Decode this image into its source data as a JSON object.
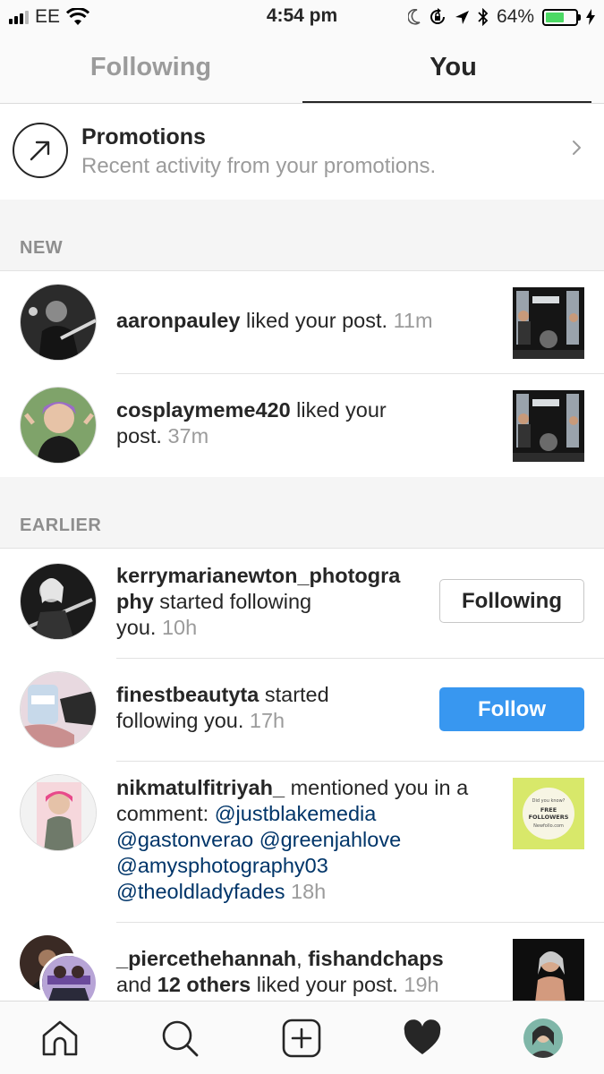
{
  "status_bar": {
    "carrier": "EE",
    "time": "4:54 pm",
    "battery_percent": "64%",
    "battery_level": 0.64,
    "icons": [
      "signal-icon",
      "wifi-icon",
      "moon-icon",
      "rotation-lock-icon",
      "location-icon",
      "bluetooth-icon",
      "battery-icon",
      "charging-icon"
    ]
  },
  "tabs": {
    "following": "Following",
    "you": "You",
    "active": "you"
  },
  "promotions": {
    "title": "Promotions",
    "subtitle": "Recent activity from your promotions.",
    "icon": "arrow-up-right-icon"
  },
  "sections": {
    "new": "NEW",
    "earlier": "EARLIER"
  },
  "new_items": [
    {
      "username": "aaronpauley",
      "action": " liked your post.",
      "time": "11m"
    },
    {
      "username": "cosplaymeme420",
      "action": " liked your post.",
      "time": "37m"
    }
  ],
  "earlier_items": [
    {
      "username": "kerrymarianewton_photography",
      "username_line1": "kerrymarianewton_photogra",
      "username_line2": "phy",
      "action": " started following you.",
      "action_line1": " started following",
      "action_line2": "you. ",
      "time": "10h",
      "button": "Following"
    },
    {
      "username": "finestbeautyta",
      "action_line1": " started",
      "action_line2": "following you. ",
      "time": "17h",
      "button": "Follow"
    },
    {
      "username": "nikmatulfitriyah_",
      "action_line1": " mentioned you in a",
      "action_line2": "comment: ",
      "mentions": [
        "@justblakemedia",
        "@gastonverao",
        "@greenjahlove",
        "@amysphotography03",
        "@theoldladyfades"
      ],
      "time": "18h",
      "thumb_text": [
        "Did you know?",
        "FREE",
        "FOLLOWERS",
        "Newfollo.com"
      ]
    },
    {
      "username1": "_piercethehannah",
      "separator": ", ",
      "username2": "fishandchaps",
      "line2_prefix": "and ",
      "others": "12 others",
      "action": " liked your post.",
      "time": "19h"
    }
  ],
  "bottom_nav": {
    "items": [
      "home-icon",
      "search-icon",
      "add-post-icon",
      "heart-icon",
      "profile-avatar"
    ]
  },
  "colors": {
    "accent_blue": "#3897f0",
    "mention_blue": "#003569",
    "muted_gray": "#9b9b9b",
    "battery_green": "#4cd964"
  }
}
